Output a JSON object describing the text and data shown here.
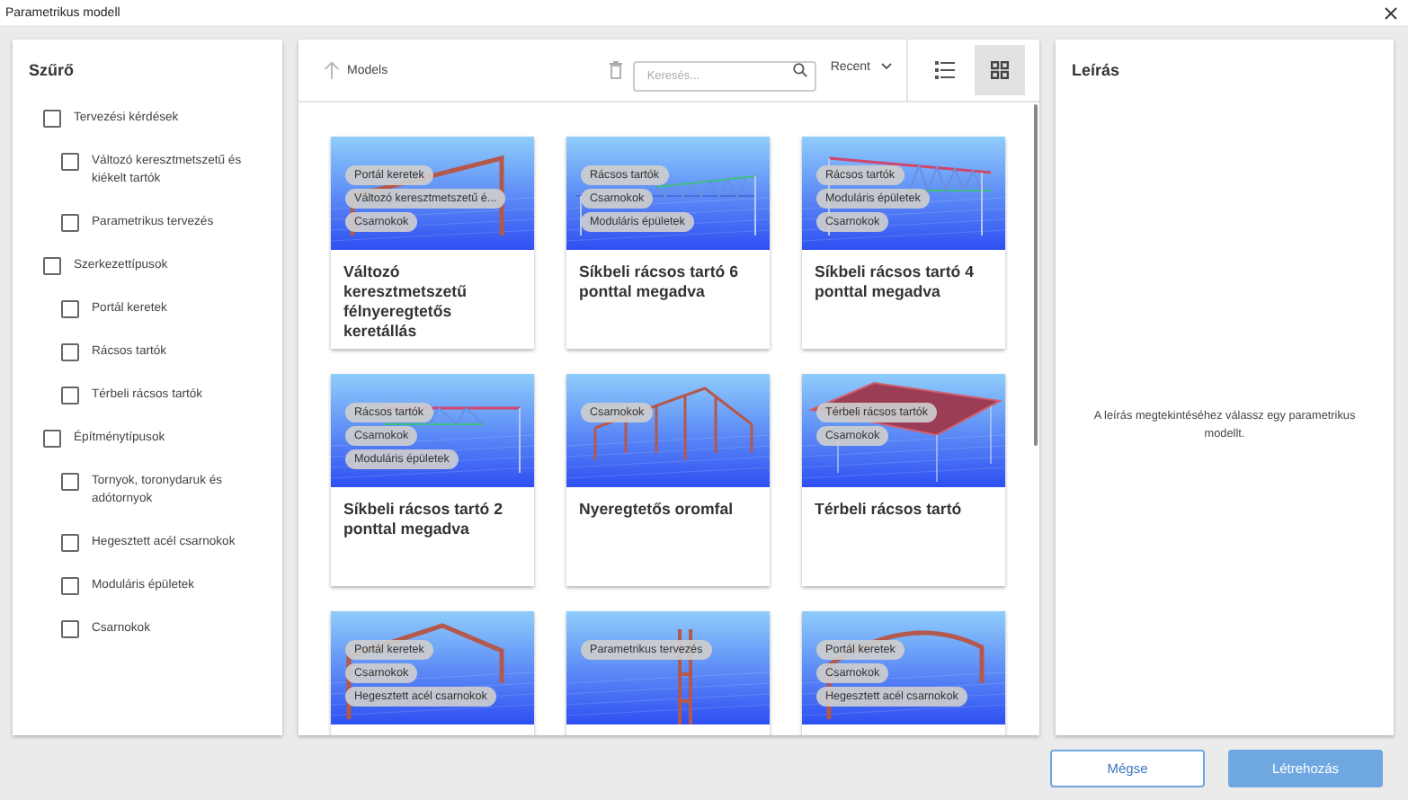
{
  "window": {
    "title": "Parametrikus modell"
  },
  "filter": {
    "title": "Szűrő",
    "items": [
      {
        "label": "Tervezési kérdések",
        "checked": false,
        "children": [
          {
            "label": "Változó keresztmetszetű és kiékelt tartók",
            "checked": false
          },
          {
            "label": "Parametrikus tervezés",
            "checked": false
          }
        ]
      },
      {
        "label": "Szerkezettípusok",
        "checked": false,
        "children": [
          {
            "label": "Portál keretek",
            "checked": false
          },
          {
            "label": "Rácsos tartók",
            "checked": false
          },
          {
            "label": "Térbeli rácsos tartók",
            "checked": false
          }
        ]
      },
      {
        "label": "Építménytípusok",
        "checked": false,
        "children": [
          {
            "label": "Tornyok, toronydaruk és adótornyok",
            "checked": false
          },
          {
            "label": "Hegesztett acél csarnokok",
            "checked": false
          },
          {
            "label": "Moduláris épületek",
            "checked": false
          },
          {
            "label": "Csarnokok",
            "checked": false
          }
        ]
      }
    ]
  },
  "toolbar": {
    "breadcrumb": "Models",
    "search": {
      "placeholder": "Keresés..."
    },
    "sort": "Recent",
    "views": [
      {
        "kind": "list",
        "selected": false
      },
      {
        "kind": "grid",
        "selected": true
      }
    ]
  },
  "models": [
    {
      "title": "Változó keresztmetszetű félnyeregtetős keretállás",
      "kind": "portal",
      "tags": [
        "Portál keretek",
        "Változó keresztmetszetű é...",
        "Csarnokok"
      ]
    },
    {
      "title": "Síkbeli rácsos tartó 6 ponttal megadva",
      "kind": "truss",
      "tags": [
        "Rácsos tartók",
        "Csarnokok",
        "Moduláris épületek"
      ]
    },
    {
      "title": "Síkbeli rácsos tartó 4 ponttal megadva",
      "kind": "truss_sloped",
      "tags": [
        "Rácsos tartók",
        "Moduláris épületek",
        "Csarnokok"
      ]
    },
    {
      "title": "Síkbeli rácsos tartó 2 ponttal megadva",
      "kind": "truss_flat",
      "tags": [
        "Rácsos tartók",
        "Csarnokok",
        "Moduláris épületek"
      ]
    },
    {
      "title": "Nyeregtetős oromfal",
      "kind": "gable",
      "tags": [
        "Csarnokok"
      ]
    },
    {
      "title": "Térbeli rácsos tartó",
      "kind": "space_truss",
      "tags": [
        "Térbeli rácsos tartók",
        "Csarnokok"
      ]
    },
    {
      "kind": "gable_frame",
      "tags": [
        "Portál keretek",
        "Csarnokok",
        "Hegesztett acél csarnokok"
      ]
    },
    {
      "kind": "column",
      "tags": [
        "Parametrikus tervezés"
      ]
    },
    {
      "kind": "arched_frame",
      "tags": [
        "Portál keretek",
        "Csarnokok",
        "Hegesztett acél csarnokok"
      ]
    }
  ],
  "description": {
    "title": "Leírás",
    "message": "A leírás megtekintéséhez válassz egy parametrikus modellt."
  },
  "buttons": [
    {
      "label": "Mégse",
      "kind": "secondary"
    },
    {
      "label": "Létrehozás",
      "kind": "primary"
    }
  ]
}
